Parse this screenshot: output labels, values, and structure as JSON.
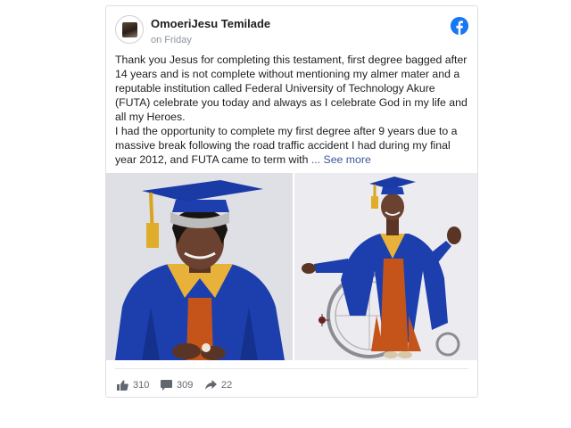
{
  "post": {
    "author": "OmoeriJesu Temilade",
    "timestamp": "on Friday",
    "paragraph1": "Thank you Jesus for completing this testament, first degree bagged after 14 years and is not complete without mentioning my almer mater and a reputable institution called Federal University of Technology Akure (FUTA) celebrate you today and always as I celebrate God in my life and all my Heroes.",
    "paragraph2": "I had the opportunity to complete my first degree after 9 years due to a massive break following the road traffic accident I had during my final year 2012, and FUTA came to term with ",
    "see_more": "... See more"
  },
  "platform_icon": "facebook-icon",
  "photos": [
    {
      "subject": "graduate in blue gown and cap, portrait"
    },
    {
      "subject": "graduate in blue gown seated in wheelchair"
    }
  ],
  "stats": {
    "likes": "310",
    "comments": "309",
    "shares": "22"
  },
  "colors": {
    "link": "#385898",
    "facebook_blue": "#1877f2",
    "gown_blue": "#1d3fae",
    "text_muted": "#606770"
  }
}
